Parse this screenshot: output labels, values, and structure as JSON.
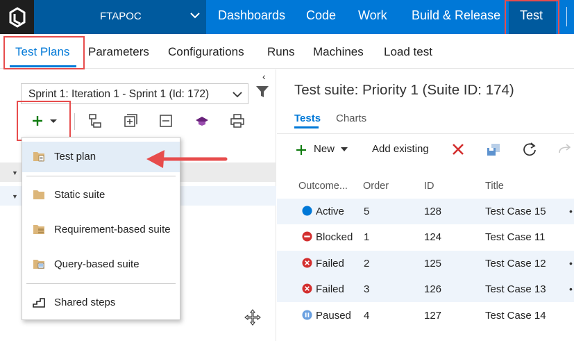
{
  "topbar": {
    "project": "FTAPOC",
    "hubs": [
      "Dashboards",
      "Code",
      "Work",
      "Build & Release",
      "Test"
    ],
    "active_hub": "Test",
    "colors": {
      "bar": "#0078d7",
      "dark": "#005a9e",
      "logo_bg": "#1e1e1e"
    }
  },
  "subnav": {
    "tabs": [
      "Test Plans",
      "Parameters",
      "Configurations",
      "Runs",
      "Machines",
      "Load test"
    ],
    "active": "Test Plans"
  },
  "left": {
    "plan_select": "Sprint 1: Iteration 1 - Sprint 1 (Id: 172)",
    "toolbar_icons": [
      "plus-icon",
      "chevron-down-icon",
      "hierarchy-icon",
      "expand-all-icon",
      "collapse-all-icon",
      "hat-icon",
      "print-icon"
    ],
    "menu": {
      "items": [
        {
          "label": "Test plan",
          "icon": "test-plan-icon",
          "highlighted": true
        },
        {
          "label": "Static suite",
          "icon": "folder-icon"
        },
        {
          "label": "Requirement-based suite",
          "icon": "requirement-suite-icon"
        },
        {
          "label": "Query-based suite",
          "icon": "query-suite-icon"
        },
        {
          "label": "Shared steps",
          "icon": "shared-steps-icon"
        }
      ]
    }
  },
  "right": {
    "suite_title": "Test suite: Priority 1 (Suite ID: 174)",
    "tabs": [
      "Tests",
      "Charts"
    ],
    "active_tab": "Tests",
    "toolbar": {
      "new_label": "New",
      "add_existing_label": "Add existing"
    },
    "columns": [
      "Outcome...",
      "Order",
      "ID",
      "Title"
    ],
    "rows": [
      {
        "outcome": "Active",
        "order": "5",
        "id": "128",
        "title": "Test Case 15",
        "status_color": "#0078d7"
      },
      {
        "outcome": "Blocked",
        "order": "1",
        "id": "124",
        "title": "Test Case 11",
        "status_color": "#d32f2f"
      },
      {
        "outcome": "Failed",
        "order": "2",
        "id": "125",
        "title": "Test Case 12",
        "status_color": "#d32f2f"
      },
      {
        "outcome": "Failed",
        "order": "3",
        "id": "126",
        "title": "Test Case 13",
        "status_color": "#d32f2f"
      },
      {
        "outcome": "Paused",
        "order": "4",
        "id": "127",
        "title": "Test Case 14",
        "status_color": "#6aa0e0"
      }
    ]
  },
  "accent": {
    "annotation_red": "#e74c4c",
    "add_green": "#107c10"
  }
}
